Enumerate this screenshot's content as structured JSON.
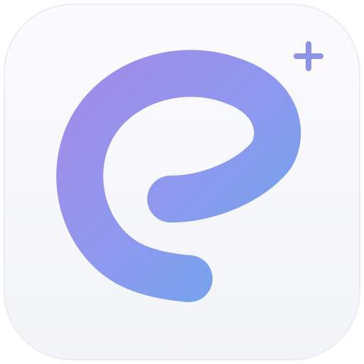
{
  "icon": {
    "name": "app-icon",
    "tile_color": "#f8f8fc",
    "tile_edge_color": "#ecedf3",
    "glyph": "e-swirl-icon",
    "badge": "plus-icon",
    "colors": {
      "gradient_start": "#a08ce8",
      "gradient_mid": "#8f98ee",
      "gradient_end": "#6fa6ec",
      "plus": "#8f93e8"
    }
  }
}
